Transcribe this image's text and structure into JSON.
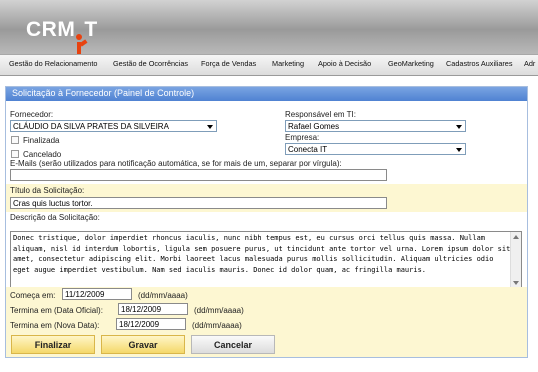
{
  "header": {
    "logo_text": "CRM",
    "logo_suffix": "T",
    "logo_color": "#e8420f"
  },
  "menu": {
    "items": [
      "Gestão do Relacionamento",
      "Gestão de Ocorrências",
      "Força de Vendas",
      "Marketing",
      "Apoio à Decisão",
      "GeoMarketing",
      "Cadastros Auxiliares",
      "Adr"
    ]
  },
  "panel": {
    "title": "Solicitação à Fornecedor (Painel de Controle)"
  },
  "form": {
    "fornecedor_label": "Fornecedor:",
    "fornecedor_value": "CLÁUDIO DA SILVA PRATES DA SILVEIRA",
    "finalizada_label": "Finalizada",
    "cancelado_label": "Cancelado",
    "responsavel_label": "Responsável em TI:",
    "responsavel_value": "Rafael Gomes",
    "empresa_label": "Empresa:",
    "empresa_value": "Conecta IT",
    "emails_label": "E-Mails (serão utilizados para notificação automática, se for mais de um, separar por vírgula):",
    "emails_value": "",
    "titulo_label": "Título da Solicitação:",
    "titulo_value": "Cras quis luctus tortor.",
    "descricao_label": "Descrição da Solicitação:",
    "descricao_value": "Donec tristique, dolor imperdiet rhoncus iaculis, nunc nibh tempus est, eu cursus orci tellus quis massa. Nullam aliquam, nisl id interdum lobortis, ligula sem posuere purus, ut tincidunt ante tortor vel urna. Lorem ipsum dolor sit amet, consectetur adipiscing elit. Morbi laoreet lacus malesuada purus mollis sollicitudin. Aliquam ultricies odio eget augue imperdiet vestibulum. Nam sed iaculis mauris. Donec id dolor quam, ac fringilla mauris.",
    "comeca_label": "Começa em:",
    "comeca_value": "11/12/2009",
    "termina_oficial_label": "Termina em (Data Oficial):",
    "termina_oficial_value": "18/12/2009",
    "termina_nova_label": "Termina em (Nova Data):",
    "termina_nova_value": "18/12/2009",
    "date_format": "(dd/mm/aaaa)"
  },
  "buttons": {
    "finalizar": "Finalizar",
    "gravar": "Gravar",
    "cancelar": "Cancelar"
  }
}
